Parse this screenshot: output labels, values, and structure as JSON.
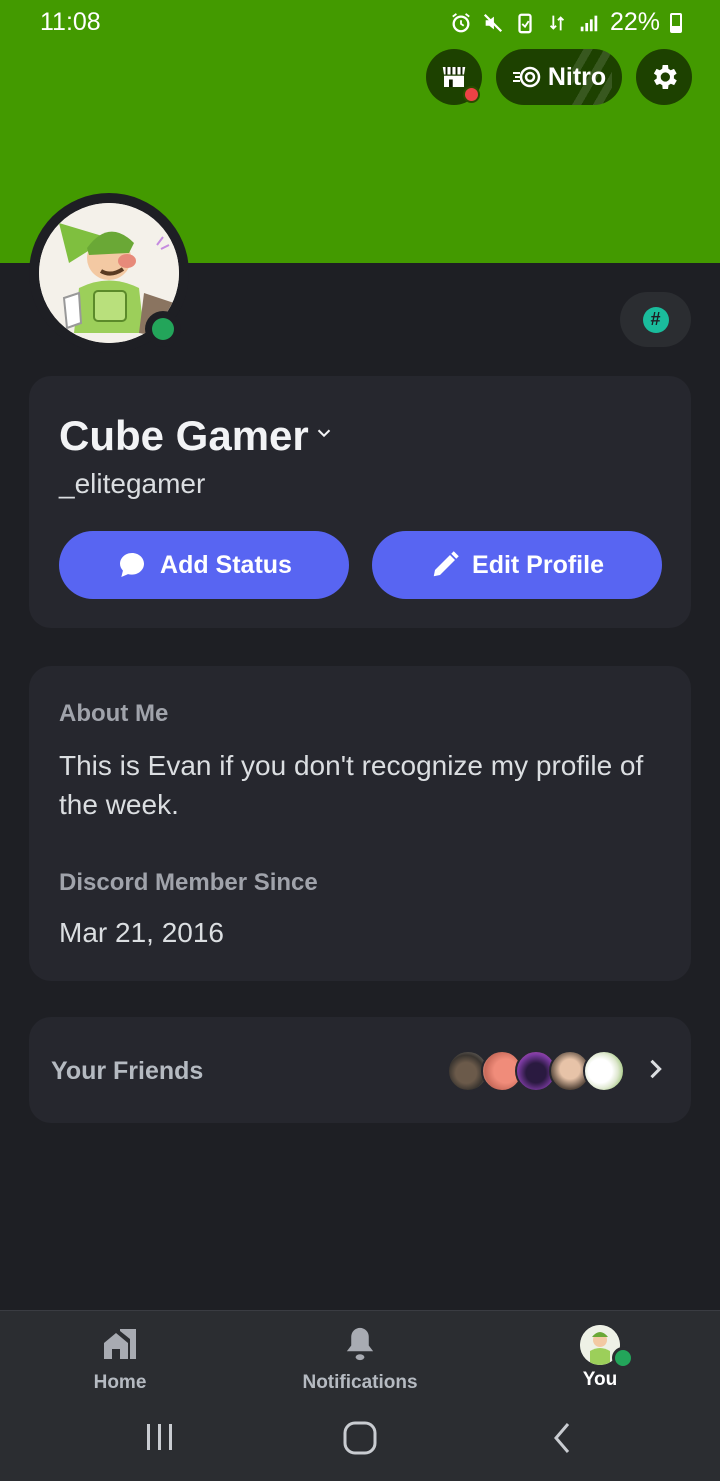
{
  "status_bar": {
    "time": "11:08",
    "battery": "22%"
  },
  "header": {
    "nitro_label": "Nitro",
    "banner_color": "#439a00",
    "icons": [
      "shop-icon",
      "nitro-icon",
      "gear-icon"
    ]
  },
  "profile": {
    "display_name": "Cube Gamer",
    "username": "_elitegamer",
    "status": "online",
    "add_status_label": "Add Status",
    "edit_profile_label": "Edit Profile"
  },
  "about": {
    "label": "About Me",
    "text": "This is Evan if you don't recognize my profile of the week.",
    "member_since_label": "Discord Member Since",
    "member_since": "Mar 21, 2016"
  },
  "friends": {
    "label": "Your Friends"
  },
  "bottom_nav": {
    "home": "Home",
    "notifications": "Notifications",
    "you": "You"
  },
  "colors": {
    "accent": "#5865f2",
    "online": "#23a55a",
    "background": "#1e1f24",
    "card": "#26272e"
  }
}
